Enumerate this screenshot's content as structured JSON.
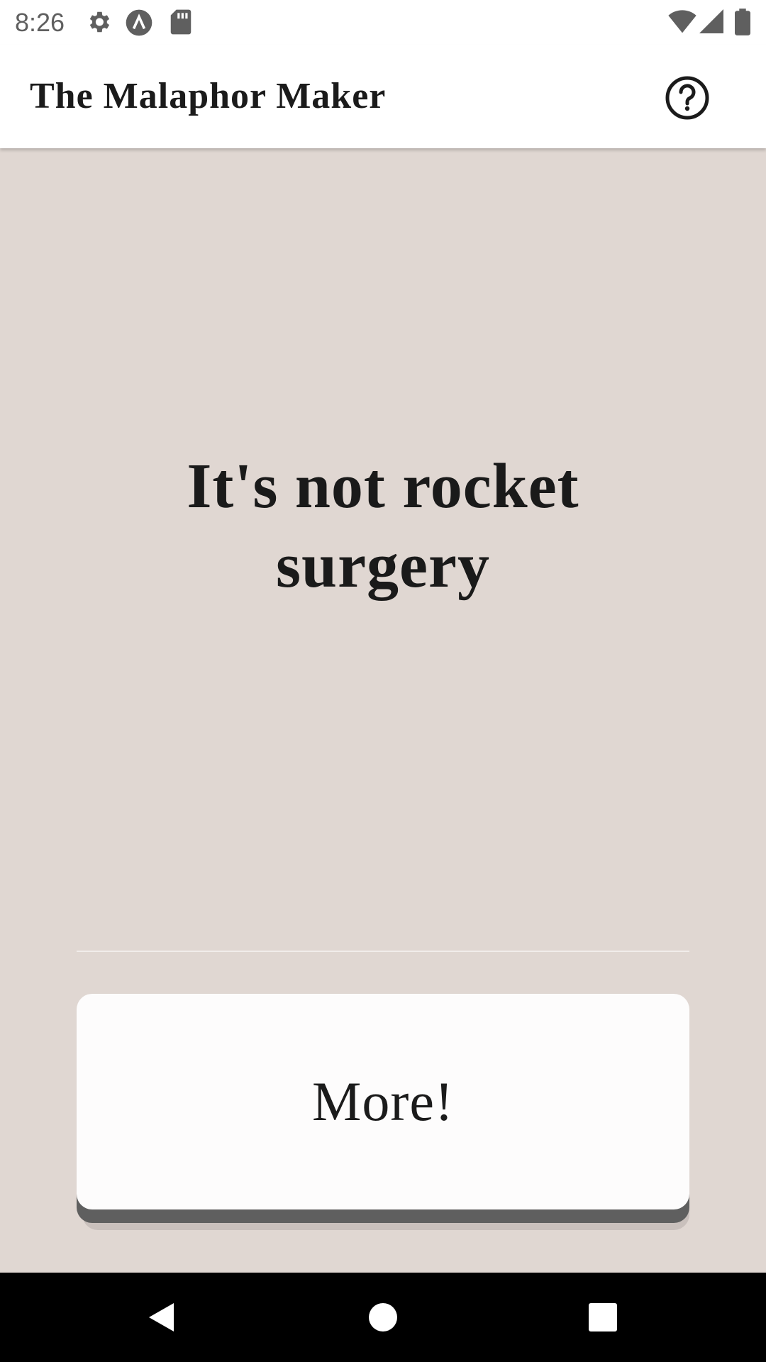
{
  "status_bar": {
    "time": "8:26",
    "icons": [
      "settings-icon",
      "app-a-icon",
      "sd-card-icon",
      "wifi-icon",
      "signal-icon",
      "battery-icon"
    ]
  },
  "app_bar": {
    "title": "The Malaphor Maker",
    "help_icon": "help-circle-icon"
  },
  "main": {
    "phrase": "It's not rocket surgery"
  },
  "more_button": {
    "label": "More!"
  },
  "nav_bar": {
    "buttons": [
      "back-icon",
      "home-icon",
      "recents-icon"
    ]
  },
  "colors": {
    "background": "#e0d7d2",
    "app_bar": "#ffffff",
    "button_face": "#fdfcfc",
    "button_shadow": "#5f5f5f",
    "text": "#1b1b1b"
  }
}
